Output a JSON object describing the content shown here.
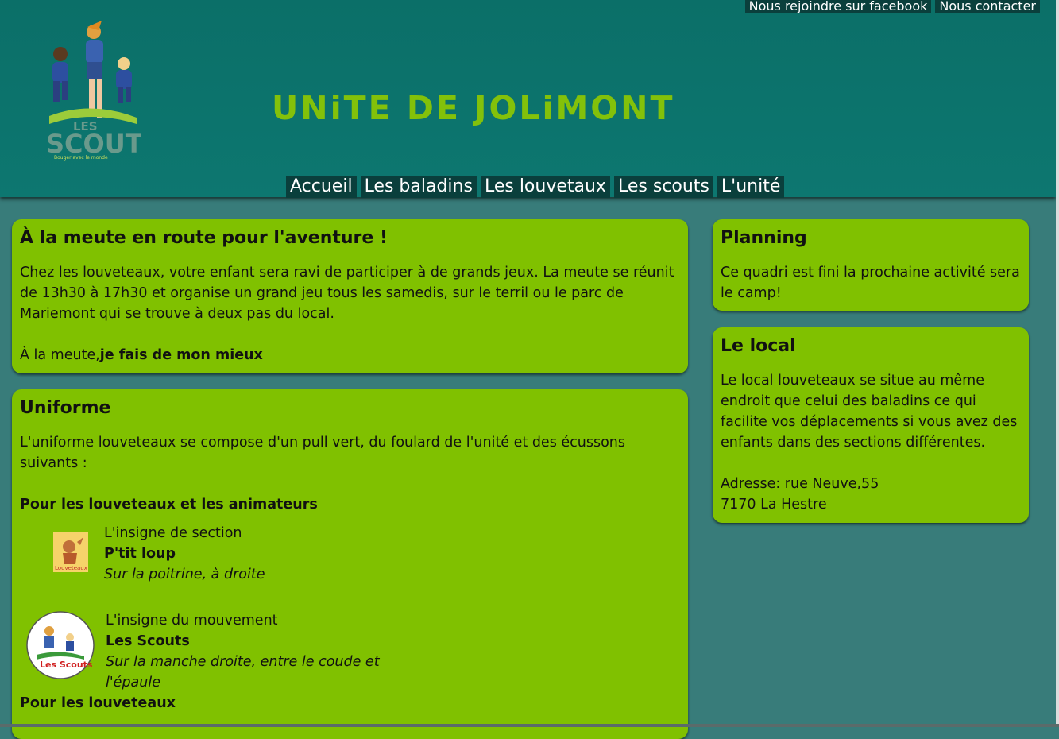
{
  "header": {
    "top_links": [
      "Nous rejoindre sur facebook",
      "Nous contacter"
    ],
    "title": "UNiTE DE JOLiMONT",
    "logo_text": "Les Scouts",
    "logo_tagline": "Bouger avec le monde",
    "nav": [
      "Accueil",
      "Les baladins",
      "Les louvetaux",
      "Les scouts",
      "L'unité"
    ]
  },
  "main": {
    "intro": {
      "title": "À la meute en route pour l'aventure !",
      "text": "Chez les louveteaux, votre enfant sera ravi de participer à de grands jeux. La meute se réunit de 13h30 à 17h30 et organise un grand jeu tous les samedis, sur le terril ou le parc de Mariemont qui se trouve à deux pas du local.",
      "motto_prefix": "À la meute,",
      "motto_bold": "je fais de mon mieux"
    },
    "uniforme": {
      "title": "Uniforme",
      "text": "L'uniforme louveteaux se compose d'un pull vert, du foulard de l'unité et des écussons suivants :",
      "subtitle_all": "Pour les louveteaux et les animateurs",
      "insignes": [
        {
          "label": "L'insigne de section",
          "name": "P'tit loup",
          "position": "Sur la poitrine, à droite",
          "badge_text": "Louveteaux"
        },
        {
          "label": "L'insigne du mouvement",
          "name": "Les Scouts",
          "position": "Sur la manche droite, entre le coude et l'épaule",
          "badge_text": "Les Scouts"
        }
      ],
      "subtitle_louveteaux": "Pour les louveteaux"
    }
  },
  "sidebar": {
    "planning": {
      "title": "Planning",
      "text": "Ce quadri est fini la prochaine activité sera le camp!"
    },
    "local": {
      "title": "Le local",
      "text": "Le local louveteaux se situe au même endroit que celui des baladins ce qui facilite vos déplacements si vous avez des enfants dans des sections différentes.",
      "address_line1": "Adresse: rue Neuve,55",
      "address_line2": "7170 La Hestre"
    }
  },
  "colors": {
    "header_bg": "#0d7770",
    "page_bg": "#387c7a",
    "panel_bg": "#80c100",
    "title_green": "#83c10a",
    "link_bg": "#0a3f3c"
  }
}
